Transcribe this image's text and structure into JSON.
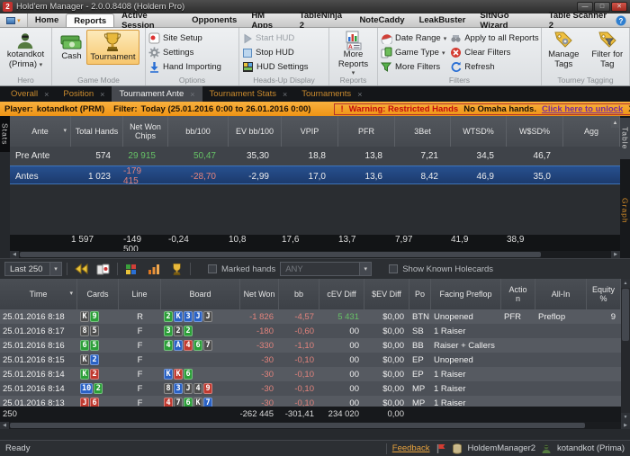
{
  "window": {
    "title": "Hold'em Manager - 2.0.0.8408 (Holdem Pro)",
    "icon_text": "2"
  },
  "icons": {
    "dropdown": "▾",
    "scroll_up": "▲",
    "scroll_down": "▼",
    "scroll_left": "◀",
    "scroll_right": "▶",
    "close_tab": "×",
    "minimize": "—",
    "maximize": "□",
    "close_window": "✕",
    "help": "?"
  },
  "menu": {
    "tabs": [
      "Home",
      "Reports",
      "Active Session",
      "Opponents",
      "HM Apps",
      "TableNinja 2",
      "NoteCaddy",
      "LeakBuster",
      "SitNGo Wizard",
      "Table Scanner 2"
    ],
    "active_tab": "Reports"
  },
  "ribbon": {
    "hero": {
      "group_label": "Hero",
      "user_line1": "kotandkot",
      "user_line2": "(Prima)"
    },
    "game_mode": {
      "group_label": "Game Mode",
      "cash": "Cash",
      "tournament": "Tournament",
      "active": "Tournament"
    },
    "options": {
      "group_label": "Options",
      "site_setup": "Site Setup",
      "settings": "Settings",
      "hand_importing": "Hand Importing"
    },
    "hud": {
      "group_label": "Heads-Up Display",
      "start": "Start HUD",
      "stop": "Stop HUD",
      "settings": "HUD Settings"
    },
    "reports": {
      "group_label": "Reports",
      "more": "More Reports"
    },
    "filters": {
      "group_label": "Filters",
      "date_range": "Date Range",
      "game_type": "Game Type",
      "more_filters": "More Filters",
      "apply_all": "Apply to all Reports",
      "clear": "Clear Filters",
      "refresh": "Refresh"
    },
    "tagging": {
      "group_label": "Tourney Tagging",
      "manage": "Manage Tags",
      "filter": "Filter for Tag"
    }
  },
  "report_tabs": {
    "tabs": [
      "Overall",
      "Position",
      "Tournament Ante",
      "Tournament Stats",
      "Tournaments"
    ],
    "active": "Tournament Ante"
  },
  "filter_bar": {
    "player_label": "Player:",
    "player": "kotandkot (PRM)",
    "filter_label": "Filter:",
    "filter_value": "Today (25.01.2016 0:00 to 26.01.2016 0:00)",
    "warning_mark": "!",
    "warning": "Warning: Restricted Hands",
    "note": "No Omaha hands.",
    "unlock_link": "Click here to unlock",
    "dismiss": "X"
  },
  "stats_panel": {
    "side_tab": "Stats",
    "right_tabs": [
      "Table",
      "Graph"
    ],
    "columns": [
      "Ante",
      "Total Hands",
      "Net Won Chips",
      "bb/100",
      "EV bb/100",
      "VPIP",
      "PFR",
      "3Bet",
      "WTSD%",
      "W$SD%",
      "Agg"
    ],
    "rows": [
      {
        "label": "Pre Ante",
        "selected": false,
        "values": [
          "574",
          "29 915",
          "50,47",
          "35,30",
          "18,8",
          "13,8",
          "7,21",
          "34,5",
          "46,7",
          ""
        ]
      },
      {
        "label": "Antes",
        "selected": true,
        "values": [
          "1 023",
          "-179 415",
          "-28,70",
          "-2,99",
          "17,0",
          "13,6",
          "8,42",
          "46,9",
          "35,0",
          ""
        ]
      }
    ],
    "totals": [
      "",
      "1 597",
      "-149 500",
      "-0,24",
      "10,8",
      "17,6",
      "13,7",
      "7,97",
      "41,9",
      "38,9",
      ""
    ]
  },
  "hands_toolbar": {
    "range_value": "Last 250",
    "marked_label": "Marked hands",
    "marked_value": "ANY",
    "show_label": "Show Known Holecards"
  },
  "hands_table": {
    "columns": [
      "Time",
      "Cards",
      "Line",
      "Board",
      "Net Won",
      "bb",
      "cEV Diff",
      "$EV Diff",
      "Po",
      "Facing Preflop",
      "Action",
      "All-In",
      "Equity %"
    ],
    "rows": [
      {
        "time": "25.01.2016 8:18",
        "cards": [
          "Ks",
          "9c"
        ],
        "line": "R",
        "board": [
          "2c",
          "Kd",
          "3d",
          "Jd",
          "Js"
        ],
        "net": "-1 826",
        "bb": "-4,57",
        "cev": "5 431",
        "sev": "$0,00",
        "pos": "BTN",
        "facing": "Unopened",
        "action": "PFR",
        "allin": "Preflop",
        "equity": "9"
      },
      {
        "time": "25.01.2016 8:17",
        "cards": [
          "8s",
          "5s"
        ],
        "line": "F",
        "board": [
          "3c",
          "2s",
          "2c"
        ],
        "net": "-180",
        "bb": "-0,60",
        "cev": "00",
        "sev": "$0,00",
        "pos": "SB",
        "facing": "1 Raiser",
        "action": "",
        "allin": "",
        "equity": ""
      },
      {
        "time": "25.01.2016 8:16",
        "cards": [
          "6c",
          "5c"
        ],
        "line": "F",
        "board": [
          "4c",
          "Ad",
          "4h",
          "6c",
          "7s"
        ],
        "net": "-330",
        "bb": "-1,10",
        "cev": "00",
        "sev": "$0,00",
        "pos": "BB",
        "facing": "Raiser + Callers",
        "action": "",
        "allin": "",
        "equity": ""
      },
      {
        "time": "25.01.2016 8:15",
        "cards": [
          "Ks",
          "2d"
        ],
        "line": "F",
        "board": [],
        "net": "-30",
        "bb": "-0,10",
        "cev": "00",
        "sev": "$0,00",
        "pos": "EP",
        "facing": "Unopened",
        "action": "",
        "allin": "",
        "equity": ""
      },
      {
        "time": "25.01.2016 8:14",
        "cards": [
          "Kc",
          "2h"
        ],
        "line": "F",
        "board": [
          "Kd",
          "Kh",
          "6c"
        ],
        "net": "-30",
        "bb": "-0,10",
        "cev": "00",
        "sev": "$0,00",
        "pos": "EP",
        "facing": "1 Raiser",
        "action": "",
        "allin": "",
        "equity": ""
      },
      {
        "time": "25.01.2016 8:14",
        "cards": [
          "10d",
          "2c"
        ],
        "line": "F",
        "board": [
          "8s",
          "3d",
          "Js",
          "4s",
          "9h"
        ],
        "net": "-30",
        "bb": "-0,10",
        "cev": "00",
        "sev": "$0,00",
        "pos": "MP",
        "facing": "1 Raiser",
        "action": "",
        "allin": "",
        "equity": ""
      },
      {
        "time": "25.01.2016 8:13",
        "cards": [
          "Jh",
          "6h"
        ],
        "line": "F",
        "board": [
          "4h",
          "7s",
          "6c",
          "Ks",
          "7d"
        ],
        "net": "-30",
        "bb": "-0,10",
        "cev": "00",
        "sev": "$0,00",
        "pos": "MP",
        "facing": "1 Raiser",
        "action": "",
        "allin": "",
        "equity": ""
      }
    ],
    "totals": {
      "label": "250",
      "net": "-262 445",
      "bb": "-301,41",
      "cev": "234 020",
      "sev": "0,00"
    }
  },
  "status_bar": {
    "ready": "Ready",
    "feedback": "Feedback",
    "database": "HoldemManager2",
    "user": "kotandkot (Prima)"
  }
}
